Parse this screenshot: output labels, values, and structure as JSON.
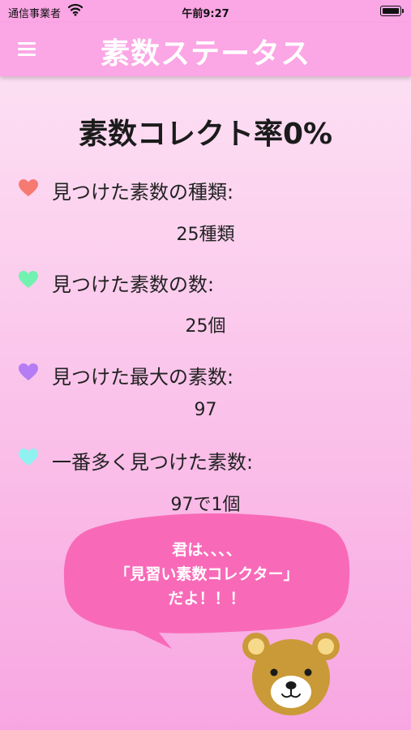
{
  "status_bar": {
    "carrier": "通信事業者",
    "time": "午前9:27"
  },
  "nav": {
    "title": "素数ステータス"
  },
  "headline": "素数コレクト率0%",
  "stats": [
    {
      "label": "見つけた素数の種類:",
      "value": "25種類",
      "heart_color": "#f77a72"
    },
    {
      "label": "見つけた素数の数:",
      "value": "25個",
      "heart_color": "#71f2b0"
    },
    {
      "label": "見つけた最大の素数:",
      "value": "97",
      "heart_color": "#b57cf4"
    },
    {
      "label": "一番多く見つけた素数:",
      "value": "97で1個",
      "heart_color": "#8ff2f0"
    }
  ],
  "speech_bubble": {
    "lines": [
      "君は、、、、",
      "「見習い素数コレクター」",
      "だよ！！！"
    ],
    "color": "#f86ab8"
  },
  "colors": {
    "bar": "#fba6e5",
    "bear_fur": "#c99a37",
    "bear_muzzle": "#ffffff"
  }
}
